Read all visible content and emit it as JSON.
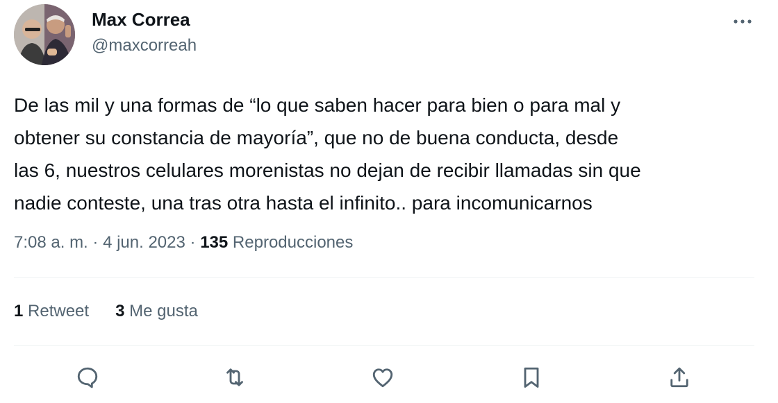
{
  "author": {
    "name": "Max Correa",
    "handle": "@maxcorreah"
  },
  "tweet": {
    "text_lines": [
      "De las mil y una formas de “lo que saben hacer para bien o para mal y",
      "obtener su constancia de mayoría”, que no de buena conducta, desde",
      "las 6, nuestros celulares morenistas no dejan de recibir llamadas sin que",
      "nadie conteste, una tras otra hasta el infinito.. para incomunicarnos"
    ]
  },
  "meta": {
    "time": "7:08 a. m.",
    "separator": "·",
    "date": "4 jun. 2023",
    "views_count": "135",
    "views_label": "Reproducciones"
  },
  "stats": {
    "retweets_count": "1",
    "retweets_label": "Retweet",
    "likes_count": "3",
    "likes_label": "Me gusta"
  },
  "actions": {
    "icons": [
      "reply-icon",
      "retweet-icon",
      "like-icon",
      "bookmark-icon",
      "share-icon"
    ]
  },
  "colors": {
    "text_primary": "#0f1419",
    "text_secondary": "#536471",
    "divider": "#eff3f4"
  }
}
